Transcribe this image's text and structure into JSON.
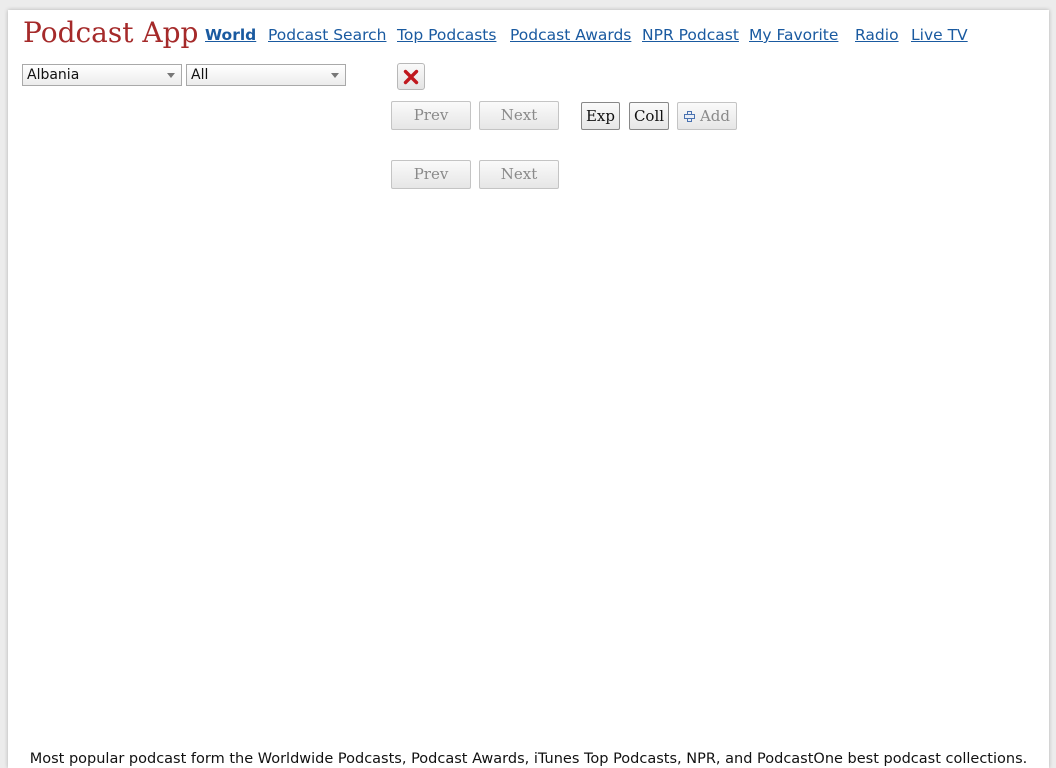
{
  "header": {
    "brand": "Podcast App",
    "nav": [
      {
        "label": "World",
        "active": true
      },
      {
        "label": "Podcast Search"
      },
      {
        "label": "Top Podcasts"
      },
      {
        "label": "Podcast Awards"
      },
      {
        "label": "NPR Podcast"
      },
      {
        "label": "My Favorite"
      },
      {
        "label": "Radio"
      },
      {
        "label": "Live TV"
      }
    ]
  },
  "filters": {
    "country": "Albania",
    "category": "All"
  },
  "toolbar": {
    "prev_label": "Prev",
    "next_label": "Next",
    "expand_label": "Exp",
    "collapse_label": "Coll",
    "add_label": "Add"
  },
  "pager_bottom": {
    "prev_label": "Prev",
    "next_label": "Next"
  },
  "footer": {
    "text": "Most popular podcast form the Worldwide Podcasts, Podcast Awards, iTunes Top Podcasts, NPR, and PodcastOne best podcast collections."
  },
  "colors": {
    "brand": "#a52a2a",
    "link": "#1a5aa0",
    "close_icon": "#c0181e"
  }
}
